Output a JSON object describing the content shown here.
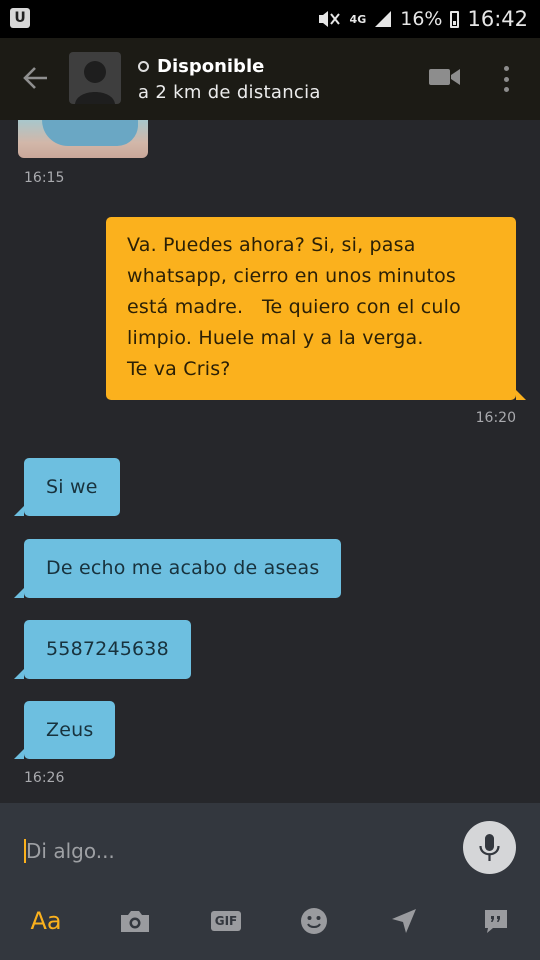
{
  "status_bar": {
    "app_badge": "U",
    "network": "4G",
    "battery": "16%",
    "clock": "16:42"
  },
  "header": {
    "status": "Disponible",
    "distance": "a 2 km de distancia"
  },
  "messages": [
    {
      "type": "timestamp",
      "text": "16:15"
    },
    {
      "type": "outgoing",
      "lines": [
        "Va. Puedes ahora? Si, si, pasa",
        "whatsapp, cierro en unos minutos",
        "está madre.   Te quiero con el culo",
        "limpio. Huele mal y a la verga.",
        "Te va Cris?"
      ]
    },
    {
      "type": "timestamp",
      "text": "16:20"
    },
    {
      "type": "incoming",
      "text": "Si we"
    },
    {
      "type": "incoming",
      "text": "De echo me acabo de aseas"
    },
    {
      "type": "incoming",
      "text": "5587245638"
    },
    {
      "type": "incoming",
      "text": "Zeus"
    },
    {
      "type": "timestamp",
      "text": "16:26"
    }
  ],
  "composer": {
    "placeholder": "Di algo...",
    "text_format_label": "Aa",
    "gif_label": "GIF"
  },
  "icons": {
    "back": "arrow-left-icon",
    "video": "video-camera-icon",
    "more": "more-vertical-icon",
    "mic": "microphone-icon",
    "camera": "camera-icon",
    "emoji": "smiley-icon",
    "location": "location-arrow-icon",
    "phrases": "quote-bubble-icon"
  },
  "colors": {
    "accent": "#fbb11d",
    "incoming_bubble": "#6dbfe0",
    "background": "#26272b"
  }
}
